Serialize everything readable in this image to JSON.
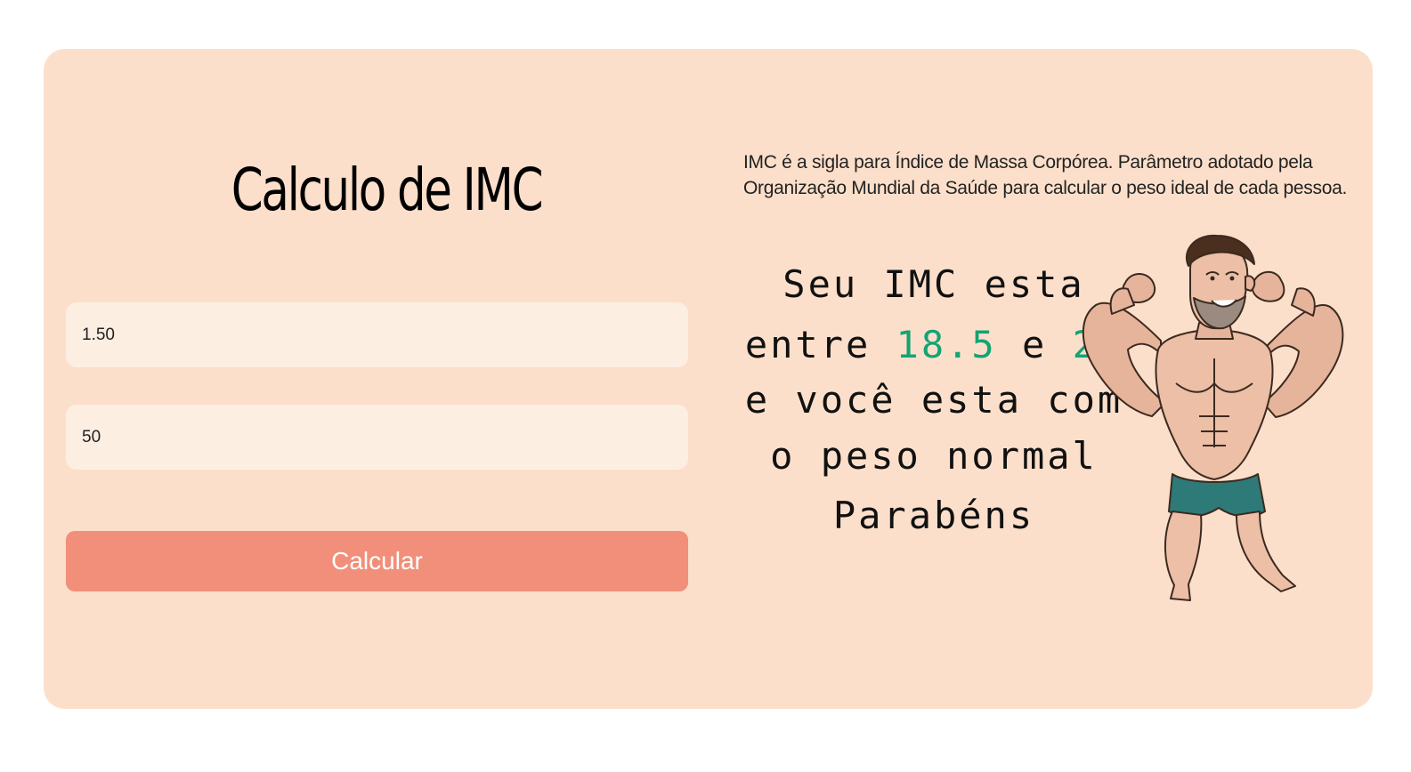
{
  "form": {
    "title": "Calculo de IMC",
    "height_value": "1.50",
    "weight_value": "50",
    "calculate_label": "Calcular"
  },
  "info": {
    "description": "IMC é a sigla para Índice de Massa Corpórea. Parâmetro adotado pela Organização Mundial da Saúde para calcular o peso ideal de cada pessoa."
  },
  "result": {
    "line1": "Seu IMC esta",
    "line2_prefix": "entre",
    "range_min": "18.5",
    "line2_mid": "e",
    "range_max": "25",
    "line3": "e você esta com",
    "line4": "o peso normal",
    "line5": "Parabéns"
  },
  "mascot": {
    "icon": "muscular-man-flexing-icon"
  },
  "colors": {
    "card_bg": "#fcdfca",
    "input_bg": "#fdeee2",
    "button_bg": "#f18f7a",
    "highlight": "#13a474"
  }
}
